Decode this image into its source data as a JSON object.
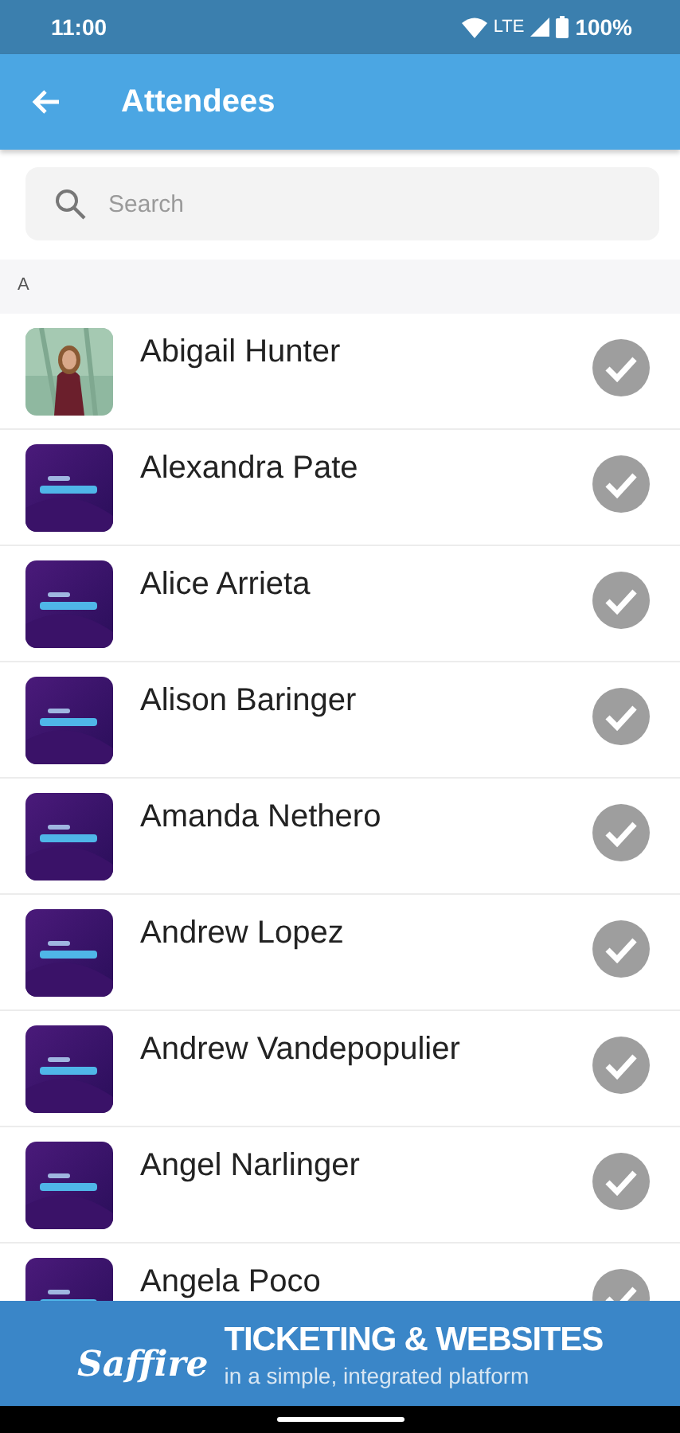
{
  "status_bar": {
    "time": "11:00",
    "network": "LTE",
    "battery": "100%"
  },
  "app_bar": {
    "title": "Attendees"
  },
  "search": {
    "placeholder": "Search"
  },
  "sections": [
    {
      "letter": "A",
      "attendees": [
        {
          "name": "Abigail Hunter",
          "checked": true
        },
        {
          "name": "Alexandra Pate",
          "kind": "logo",
          "checked": true
        },
        {
          "name": "Alice Arrieta",
          "kind": "logo",
          "checked": true
        },
        {
          "name": "Alison Baringer",
          "kind": "logo",
          "checked": true
        },
        {
          "name": "Amanda Nethero",
          "kind": "logo",
          "checked": true
        },
        {
          "name": "Andrew Lopez",
          "kind": "logo",
          "checked": true
        },
        {
          "name": "Andrew Vandepopulier",
          "kind": "logo",
          "checked": true
        },
        {
          "name": "Angel Narlinger",
          "kind": "logo",
          "checked": true
        },
        {
          "name": "Angela Poco",
          "kind": "logo",
          "checked": true
        }
      ]
    }
  ],
  "banner": {
    "brand": "Saffire",
    "headline": "TICKETING & WEBSITES",
    "tagline": "in a simple, integrated platform"
  }
}
